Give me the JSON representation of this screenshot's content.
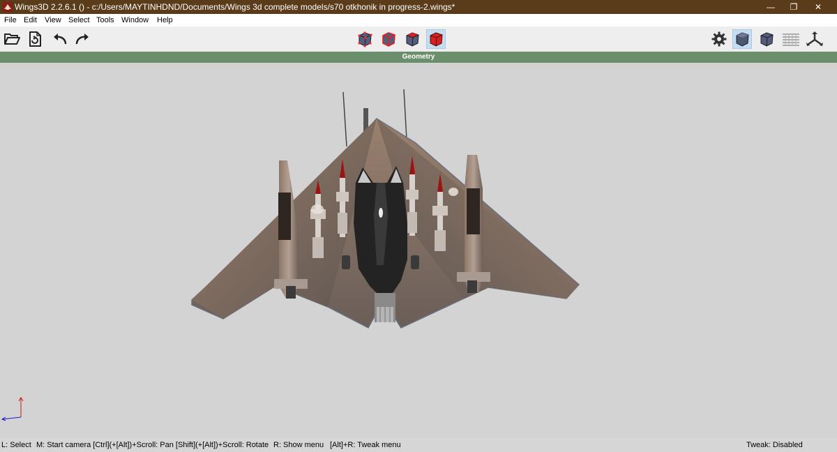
{
  "window": {
    "title": "Wings3D 2.2.6.1 () - c:/Users/MAYTINHDND/Documents/Wings 3d complete models/s70 otkhonik in progress-2.wings*",
    "app_icon": "wings3d-logo-icon",
    "controls": {
      "minimize": "—",
      "maximize": "❐",
      "close": "✕"
    }
  },
  "menubar": {
    "items": [
      "File",
      "Edit",
      "View",
      "Select",
      "Tools",
      "Window",
      "Help"
    ]
  },
  "toolbar": {
    "left": [
      "open-folder-icon",
      "import-icon",
      "undo-icon",
      "redo-icon"
    ],
    "selection_modes": [
      "vertex-mode-icon",
      "edge-mode-icon",
      "face-mode-icon",
      "body-mode-icon"
    ],
    "active_mode": "body-mode-icon",
    "right": [
      "gear-icon",
      "smooth-shaded-cube-icon",
      "flat-shaded-cube-icon",
      "ground-plane-icon",
      "axes-icon"
    ]
  },
  "viewport": {
    "header": "Geometry",
    "header_color": "#6a8f6a",
    "background": "#d3d3d3",
    "model": "aircraft-model"
  },
  "statusbar": {
    "select": "L: Select",
    "camera": "M: Start camera  [Ctrl](+[Alt])+Scroll: Pan  [Shift](+[Alt])+Scroll: Rotate",
    "menu": "R: Show menu",
    "tweak_menu": "[Alt]+R: Tweak menu",
    "tweak_status": "Tweak: Disabled"
  },
  "colors": {
    "titlebar": "#5a3c1a",
    "accent_active": "#c6dcef",
    "face_selection": "#cc1a1a"
  }
}
